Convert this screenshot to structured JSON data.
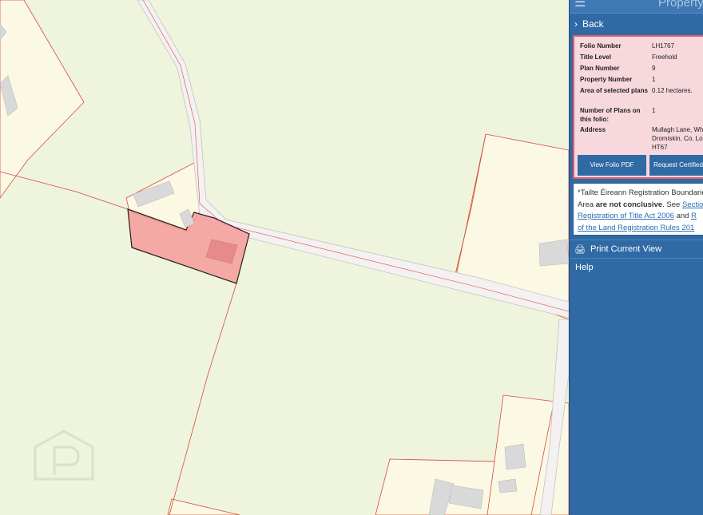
{
  "panel": {
    "title": "Property",
    "menu_icon": "hamburger-icon",
    "back_label": "Back",
    "folio": [
      {
        "label": "Folio Number",
        "value": "LH1767"
      },
      {
        "label": "Title Level",
        "value": "Freehold"
      },
      {
        "label": "Plan Number",
        "value": "9"
      },
      {
        "label": "Property Number",
        "value": "1"
      },
      {
        "label": "Area of selected plans",
        "value": "0.12 hectares."
      },
      {
        "label": "Number of Plans on this folio:",
        "value": "1"
      },
      {
        "label": "Address",
        "value": "Mullagh Lane, Wh",
        "value2": "Dromiskin, Co. Lo",
        "value3": "HT67"
      }
    ],
    "buttons": {
      "view_pdf": "View Folio PDF",
      "request_cert": "Request Certified"
    },
    "notice": {
      "line1": "*Tailte Éireann Registration Boundaries",
      "line2_pre": "Area ",
      "line2_bold": "are not conclusive",
      "line2_post": ". See ",
      "line2_link": "Section",
      "line3_link": "Registration of Title Act 2006",
      "line3_and": " and ",
      "line3_link2": "R",
      "line4_link": "of the Land Registration Rules 201"
    },
    "print_label": "Print Current View",
    "help_label": "Help"
  },
  "map": {
    "watermark_icon": "property-logo-icon",
    "colors": {
      "land": "#eef5dc",
      "boundary": "#d9493f",
      "selected_fill": "#f59b9b",
      "road": "#f3f1f1",
      "building": "#d9d9d9"
    }
  }
}
